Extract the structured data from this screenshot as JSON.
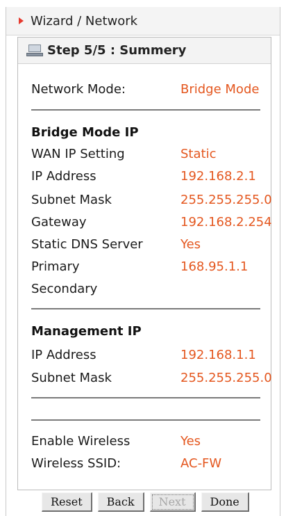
{
  "header": {
    "title": "Wizard / Network"
  },
  "panel": {
    "title": "Step 5/5 : Summery"
  },
  "network_mode": {
    "label": "Network Mode:",
    "value": "Bridge Mode"
  },
  "bridge": {
    "heading": "Bridge Mode IP",
    "rows": [
      {
        "label": "WAN IP Setting",
        "value": "Static"
      },
      {
        "label": "IP Address",
        "value": "192.168.2.1"
      },
      {
        "label": "Subnet Mask",
        "value": "255.255.255.0"
      },
      {
        "label": "Gateway",
        "value": "192.168.2.254"
      },
      {
        "label": "Static DNS Server",
        "value": "Yes"
      },
      {
        "label": "Primary",
        "value": "168.95.1.1"
      },
      {
        "label": "Secondary",
        "value": ""
      }
    ]
  },
  "management": {
    "heading": "Management IP",
    "rows": [
      {
        "label": "IP Address",
        "value": "192.168.1.1"
      },
      {
        "label": "Subnet Mask",
        "value": "255.255.255.0"
      }
    ]
  },
  "wireless": {
    "rows": [
      {
        "label": "Enable Wireless",
        "value": "Yes"
      },
      {
        "label": "Wireless SSID:",
        "value": "AC-FW"
      }
    ]
  },
  "buttons": {
    "reset": "Reset",
    "back": "Back",
    "next": "Next",
    "done": "Done"
  },
  "colors": {
    "value_text": "#e4571f",
    "arrow": "#e63a2e"
  }
}
